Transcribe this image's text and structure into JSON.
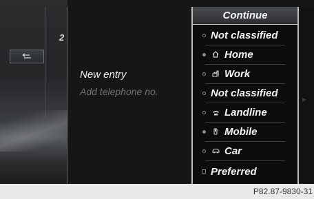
{
  "left": {
    "page_number": "2",
    "back_icon": "back-arrow-icon"
  },
  "entry": {
    "title": "New entry",
    "subtitle": "Add telephone no."
  },
  "menu": {
    "continue_label": "Continue",
    "items": [
      {
        "label": "Not classified",
        "marker": "radio",
        "selected": false,
        "icon": ""
      },
      {
        "label": "Home",
        "marker": "radio",
        "selected": true,
        "icon": "home-icon"
      },
      {
        "label": "Work",
        "marker": "radio",
        "selected": false,
        "icon": "work-icon"
      },
      {
        "label": "Not classified",
        "marker": "radio",
        "selected": false,
        "icon": ""
      },
      {
        "label": "Landline",
        "marker": "radio",
        "selected": false,
        "icon": "landline-phone-icon"
      },
      {
        "label": "Mobile",
        "marker": "radio",
        "selected": true,
        "icon": "mobile-phone-icon"
      },
      {
        "label": "Car",
        "marker": "radio",
        "selected": false,
        "icon": "car-phone-icon"
      },
      {
        "label": "Preferred",
        "marker": "checkbox",
        "selected": false,
        "icon": ""
      }
    ]
  },
  "caption": "P82.87-9830-31"
}
